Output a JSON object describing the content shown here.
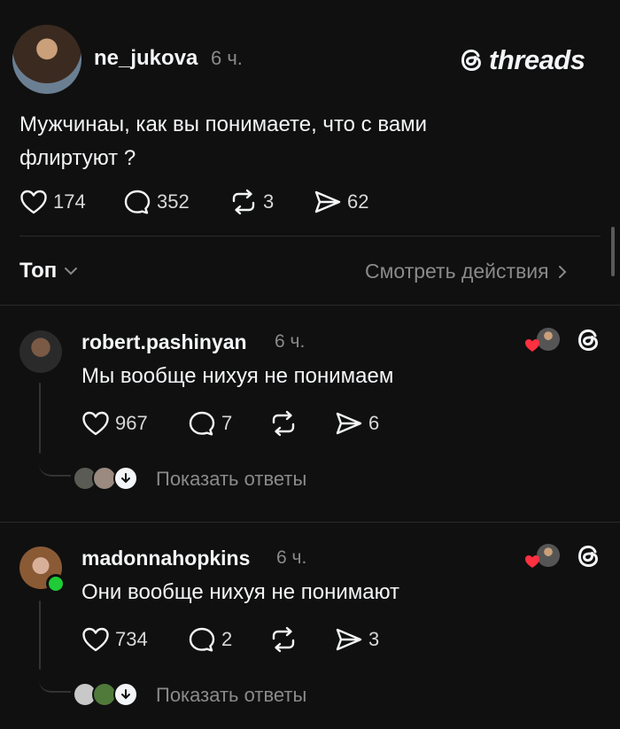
{
  "post": {
    "username": "ne_jukova",
    "time": "6 ч.",
    "brand": "threads",
    "text_line1": "Мужчинаы, как вы понимаете, что с вами",
    "text_line2": "флиртуют ?",
    "likes": "174",
    "comments": "352",
    "reposts": "3",
    "shares": "62"
  },
  "sort_bar": {
    "sort_label": "Топ",
    "view_activity": "Смотреть действия"
  },
  "replies": [
    {
      "username": "robert.pashinyan",
      "time": "6 ч.",
      "text": "Мы вообще нихуя не понимаем",
      "likes": "967",
      "comments": "7",
      "reposts": "",
      "shares": "6",
      "show_replies": "Показать ответы"
    },
    {
      "username": "madonnahopkins",
      "time": "6 ч.",
      "text": "Они вообще нихуя не понимают",
      "likes": "734",
      "comments": "2",
      "reposts": "",
      "shares": "3",
      "show_replies": "Показать ответы",
      "online": true
    }
  ],
  "colors": {
    "background": "#101010",
    "text": "#f3f5f7",
    "muted": "#8a8a8a",
    "heart_red": "#ff3040",
    "online_green": "#1fcb36"
  }
}
